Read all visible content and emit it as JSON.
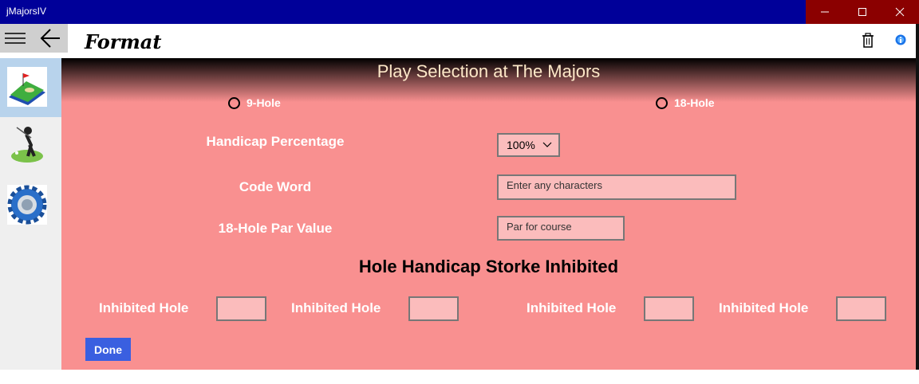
{
  "window": {
    "title": "jMajorsIV"
  },
  "appbar": {
    "page_title": "Format"
  },
  "main": {
    "heading": "Play Selection at The Majors",
    "holes_options": [
      {
        "label": "9-Hole",
        "selected": false
      },
      {
        "label": "18-Hole",
        "selected": false
      }
    ],
    "handicap_label": "Handicap Percentage",
    "handicap_value": "100%",
    "code_word_label": "Code Word",
    "code_word_placeholder": "Enter any characters",
    "par_label": "18-Hole Par Value",
    "par_placeholder": "Par for course",
    "inhibited_heading": "Hole Handicap Storke Inhibited",
    "inhibited_label": "Inhibited Hole",
    "done_label": "Done"
  },
  "colors": {
    "titlebar": "#000099",
    "window_controls": "#8b0000",
    "content_bg": "#f99090",
    "field_bg": "#fbbcbc",
    "done_button": "#3a5fe0",
    "sidebar_selected": "#b8d3ec"
  },
  "sidebar": {
    "items": [
      "golf-course-icon",
      "golfer-icon",
      "settings-gear-icon"
    ]
  }
}
